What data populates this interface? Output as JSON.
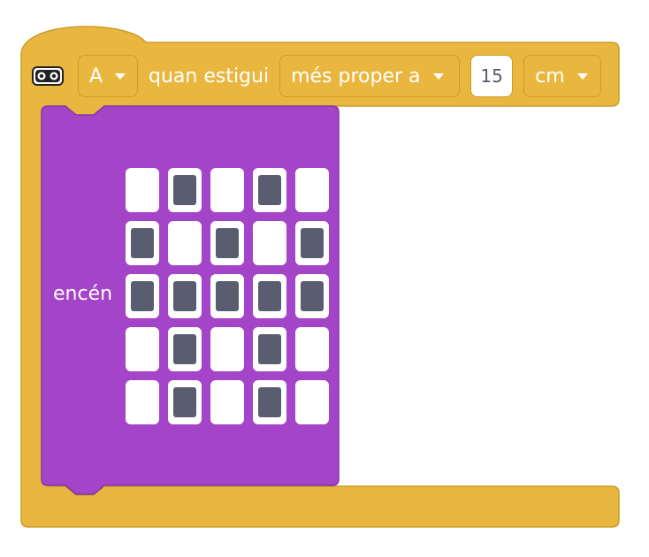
{
  "hat_block": {
    "color": "#e9b73f",
    "border_color": "#c99d2a",
    "sensor_icon": "distance-sensor-icon",
    "port_dropdown": {
      "value": "A"
    },
    "when_label": "quan estigui",
    "comparison_dropdown": {
      "value": "més proper a"
    },
    "distance_input": {
      "value": "15"
    },
    "unit_dropdown": {
      "value": "cm"
    }
  },
  "matrix_block": {
    "color": "#a444c8",
    "border_color": "#8734a8",
    "label": "encén",
    "pixel_on_color": "#585d6f",
    "pixels": [
      [
        0,
        1,
        0,
        1,
        0
      ],
      [
        1,
        0,
        1,
        0,
        1
      ],
      [
        1,
        1,
        1,
        1,
        1
      ],
      [
        0,
        1,
        0,
        1,
        0
      ],
      [
        0,
        1,
        0,
        1,
        0
      ]
    ]
  }
}
